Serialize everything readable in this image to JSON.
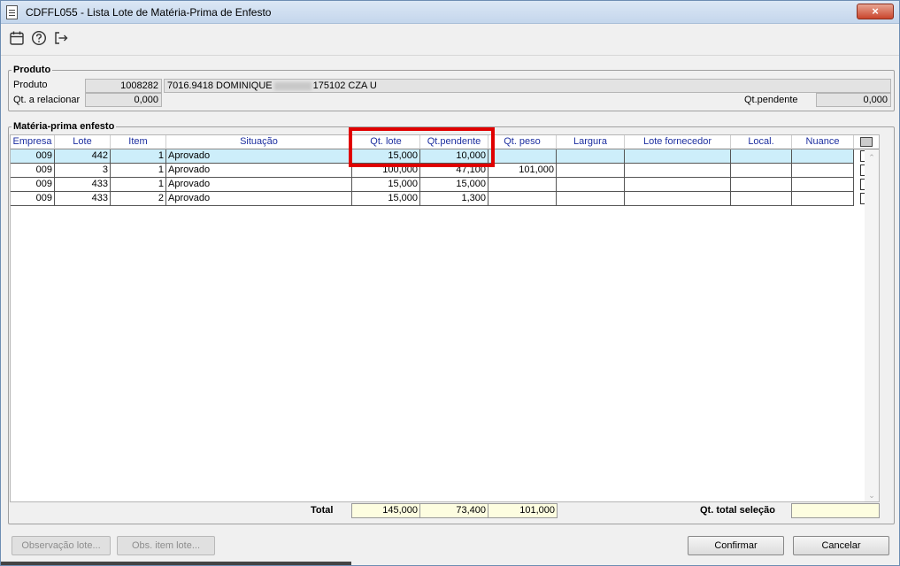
{
  "window": {
    "title": "CDFFL055 - Lista Lote de Matéria-Prima de Enfesto",
    "close_label": "×"
  },
  "toolbar": {
    "icons": [
      "calendar-icon",
      "help-icon",
      "exit-icon"
    ]
  },
  "produto": {
    "group_title": "Produto",
    "produto_label": "Produto",
    "produto_code": "1008282",
    "produto_desc_part1": "7016.9418 DOMINIQUE",
    "produto_desc_part2": "175102 CZA U",
    "qt_relacionar_label": "Qt. a relacionar",
    "qt_relacionar_value": "0,000",
    "qt_pendente_label": "Qt.pendente",
    "qt_pendente_value": "0,000"
  },
  "materia": {
    "group_title": "Matéria-prima enfesto",
    "columns": [
      "Empresa",
      "Lote",
      "Item",
      "Situação",
      "Qt. lote",
      "Qt.pendente",
      "Qt. peso",
      "Largura",
      "Lote fornecedor",
      "Local.",
      "Nuance"
    ],
    "rows": [
      {
        "empresa": "009",
        "lote": "442",
        "item": "1",
        "situacao": "Aprovado",
        "qt_lote": "15,000",
        "qt_pendente": "10,000",
        "qt_peso": "",
        "largura": "",
        "lote_fornecedor": "",
        "local": "",
        "nuance": ""
      },
      {
        "empresa": "009",
        "lote": "3",
        "item": "1",
        "situacao": "Aprovado",
        "qt_lote": "100,000",
        "qt_pendente": "47,100",
        "qt_peso": "101,000",
        "largura": "",
        "lote_fornecedor": "",
        "local": "",
        "nuance": ""
      },
      {
        "empresa": "009",
        "lote": "433",
        "item": "1",
        "situacao": "Aprovado",
        "qt_lote": "15,000",
        "qt_pendente": "15,000",
        "qt_peso": "",
        "largura": "",
        "lote_fornecedor": "",
        "local": "",
        "nuance": ""
      },
      {
        "empresa": "009",
        "lote": "433",
        "item": "2",
        "situacao": "Aprovado",
        "qt_lote": "15,000",
        "qt_pendente": "1,300",
        "qt_peso": "",
        "largura": "",
        "lote_fornecedor": "",
        "local": "",
        "nuance": ""
      }
    ]
  },
  "totals": {
    "total_label": "Total",
    "qt_lote": "145,000",
    "qt_pendente": "73,400",
    "qt_peso": "101,000",
    "selection_label": "Qt. total seleção",
    "selection_value": ""
  },
  "buttons": {
    "observacao_lote": "Observação lote...",
    "obs_item_lote": "Obs. item lote...",
    "confirmar": "Confirmar",
    "cancelar": "Cancelar"
  },
  "colors": {
    "highlight": "#e00000",
    "selected_row": "#cdeefa",
    "header_text": "#1d2fa0"
  }
}
